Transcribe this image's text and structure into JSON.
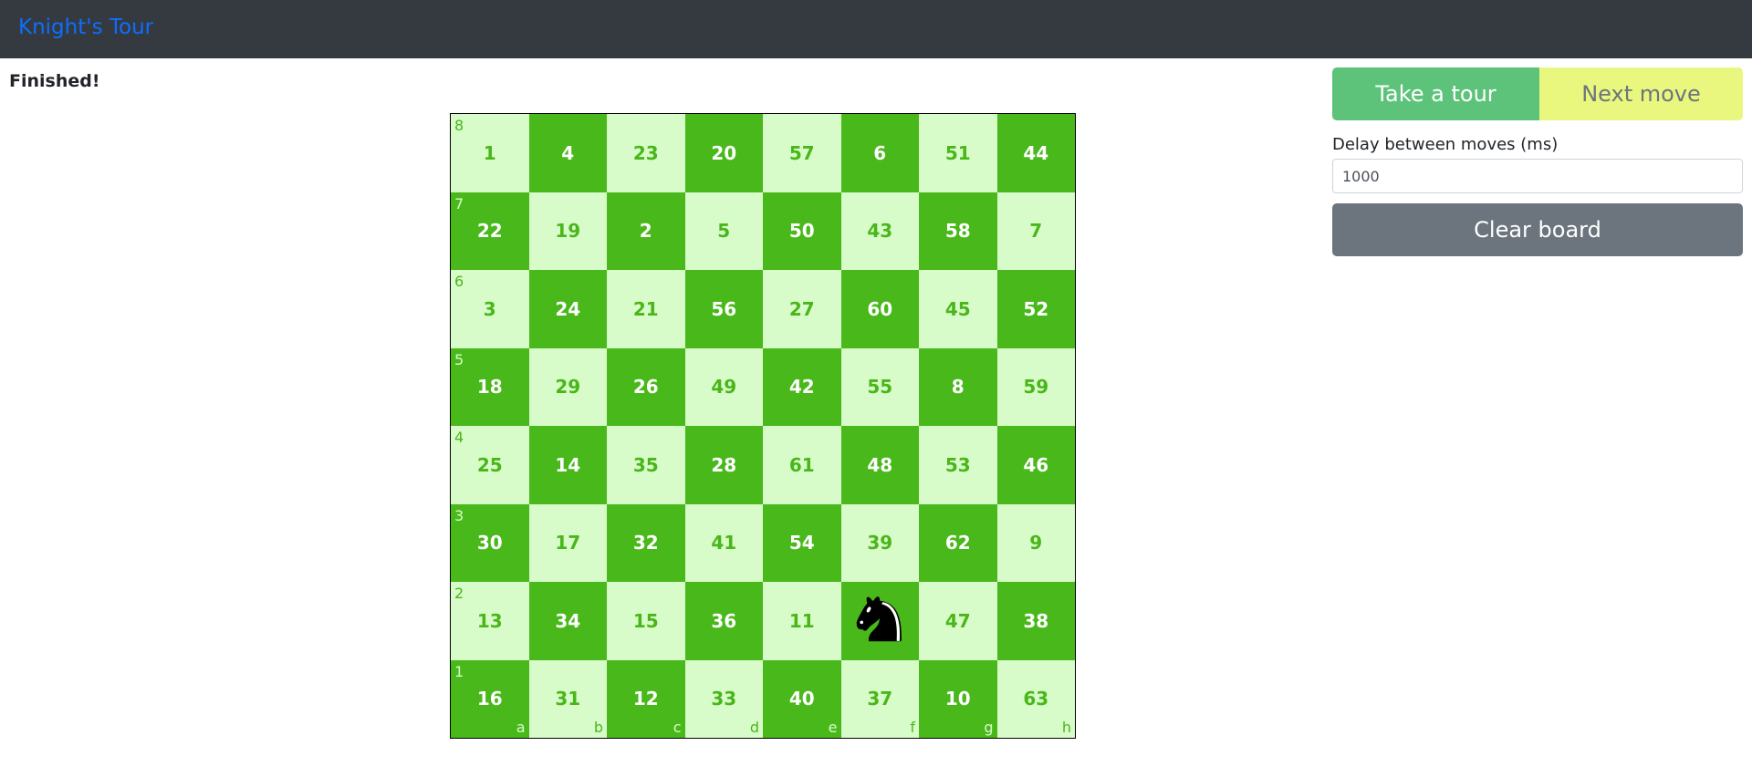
{
  "navbar": {
    "brand": "Knight's Tour"
  },
  "status": "Finished!",
  "board": {
    "files": [
      "a",
      "b",
      "c",
      "d",
      "e",
      "f",
      "g",
      "h"
    ],
    "ranks": [
      "8",
      "7",
      "6",
      "5",
      "4",
      "3",
      "2",
      "1"
    ],
    "cells": [
      [
        "1",
        "4",
        "23",
        "20",
        "57",
        "6",
        "51",
        "44"
      ],
      [
        "22",
        "19",
        "2",
        "5",
        "50",
        "43",
        "58",
        "7"
      ],
      [
        "3",
        "24",
        "21",
        "56",
        "27",
        "60",
        "45",
        "52"
      ],
      [
        "18",
        "29",
        "26",
        "49",
        "42",
        "55",
        "8",
        "59"
      ],
      [
        "25",
        "14",
        "35",
        "28",
        "61",
        "48",
        "53",
        "46"
      ],
      [
        "30",
        "17",
        "32",
        "41",
        "54",
        "39",
        "62",
        "9"
      ],
      [
        "13",
        "34",
        "15",
        "36",
        "11",
        "",
        "47",
        "38"
      ],
      [
        "16",
        "31",
        "12",
        "33",
        "40",
        "37",
        "10",
        "63"
      ]
    ],
    "knight_square": "f2",
    "colors": {
      "light": "#d8fcc9",
      "dark": "#49b81a"
    }
  },
  "controls": {
    "take_tour_label": "Take a tour",
    "next_move_label": "Next move",
    "delay_label": "Delay between moves (ms)",
    "delay_value": "1000",
    "clear_label": "Clear board",
    "colors": {
      "take_tour": "#5ec37a",
      "next_move": "#e9f77e",
      "clear": "#6c757d"
    }
  }
}
